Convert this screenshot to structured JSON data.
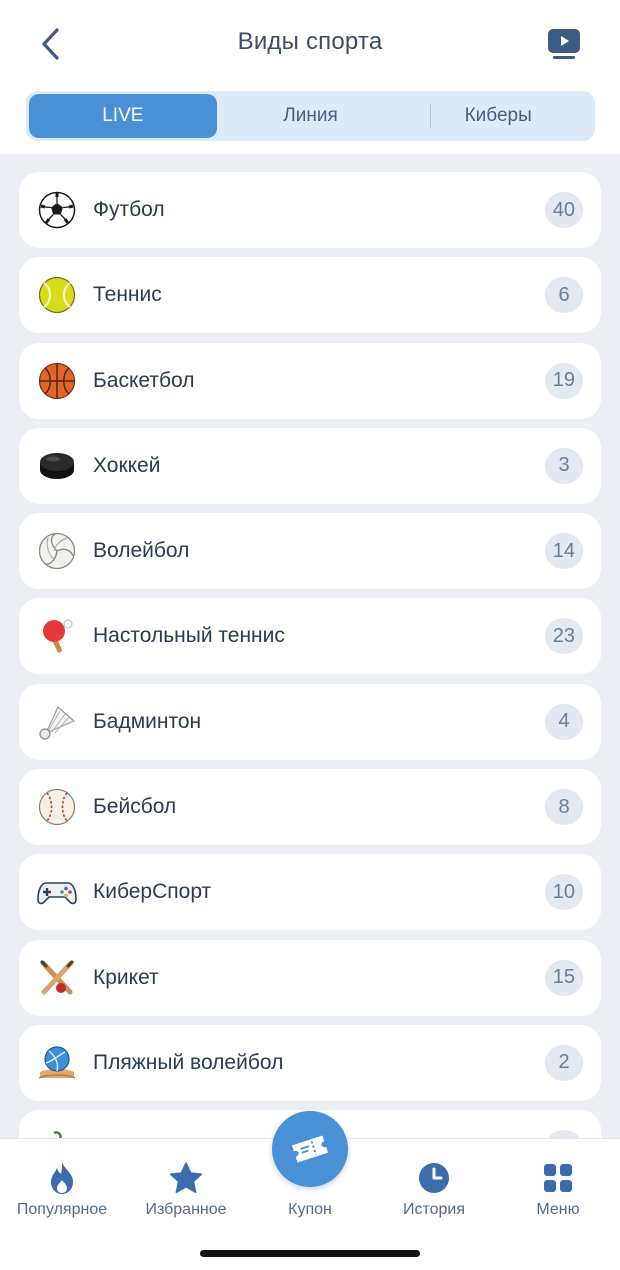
{
  "header": {
    "title": "Виды спорта",
    "back_icon": "chevron-left-icon",
    "tv_icon": "tv-play-icon"
  },
  "segments": [
    {
      "label": "LIVE",
      "active": true
    },
    {
      "label": "Линия",
      "active": false
    },
    {
      "label": "Киберы",
      "active": false
    }
  ],
  "sports": [
    {
      "name": "Футбол",
      "count": "40",
      "icon": "soccer-ball-icon"
    },
    {
      "name": "Теннис",
      "count": "6",
      "icon": "tennis-ball-icon"
    },
    {
      "name": "Баскетбол",
      "count": "19",
      "icon": "basketball-icon"
    },
    {
      "name": "Хоккей",
      "count": "3",
      "icon": "hockey-puck-icon"
    },
    {
      "name": "Волейбол",
      "count": "14",
      "icon": "volleyball-icon"
    },
    {
      "name": "Настольный теннис",
      "count": "23",
      "icon": "ping-pong-paddle-icon"
    },
    {
      "name": "Бадминтон",
      "count": "4",
      "icon": "shuttlecock-icon"
    },
    {
      "name": "Бейсбол",
      "count": "8",
      "icon": "baseball-icon"
    },
    {
      "name": "КиберСпорт",
      "count": "10",
      "icon": "gamepad-icon"
    },
    {
      "name": "Крикет",
      "count": "15",
      "icon": "cricket-icon"
    },
    {
      "name": "Пляжный волейбол",
      "count": "2",
      "icon": "beach-volleyball-icon"
    },
    {
      "name": "",
      "count": "",
      "icon": "partial-sport-icon"
    }
  ],
  "tabbar": [
    {
      "label": "Популярное",
      "icon": "flame-icon"
    },
    {
      "label": "Избранное",
      "icon": "star-icon"
    },
    {
      "label": "Купон",
      "icon": "ticket-icon"
    },
    {
      "label": "История",
      "icon": "clock-icon"
    },
    {
      "label": "Меню",
      "icon": "grid-icon"
    }
  ],
  "colors": {
    "accent": "#4a90d6",
    "background": "#ebeef3",
    "tab_icon": "#3a6cae"
  }
}
